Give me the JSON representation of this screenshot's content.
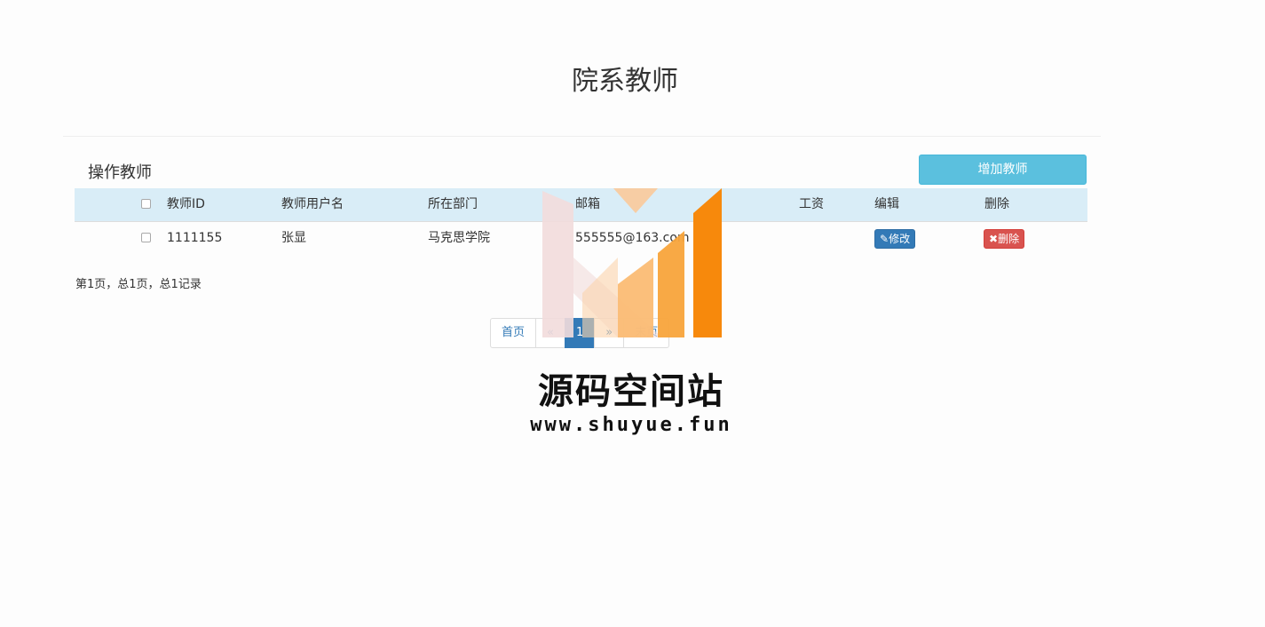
{
  "page": {
    "title": "院系教师"
  },
  "section": {
    "title": "操作教师",
    "add_button": "增加教师"
  },
  "table": {
    "headers": [
      "教师ID",
      "教师用户名",
      "所在部门",
      "邮箱",
      "工资",
      "编辑",
      "删除"
    ],
    "rows": [
      {
        "id": "1111155",
        "username": "张显",
        "department": "马克思学院",
        "email": "555555@163.com",
        "salary": "",
        "edit_label": "修改",
        "delete_label": "删除"
      }
    ]
  },
  "pager": {
    "info": "第1页，总1页，总1记录",
    "first": "首页",
    "prev": "«",
    "current": "1",
    "next": "»",
    "last": "末页"
  },
  "watermark": {
    "title": "源码空间站",
    "url": "www.shuyue.fun"
  },
  "colors": {
    "header_bg": "#d9edf7",
    "info_btn": "#5bc0de",
    "primary": "#337ab7",
    "danger": "#d9534f",
    "wm_orange": "#f7890c",
    "wm_pink": "#f2dcdb"
  }
}
